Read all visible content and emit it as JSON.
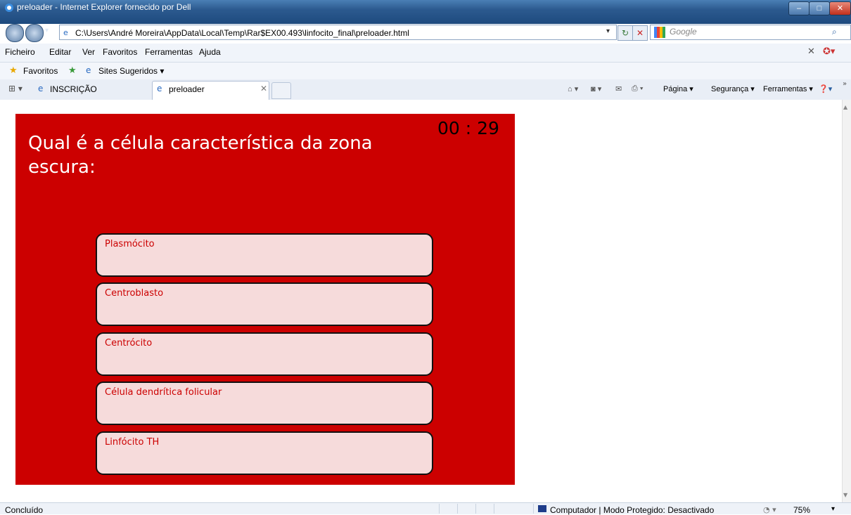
{
  "window": {
    "title": "preloader - Internet Explorer fornecido por Dell",
    "minimize": "–",
    "maximize": "□",
    "close": "✕"
  },
  "address_bar": {
    "url": "C:\\Users\\André Moreira\\AppData\\Local\\Temp\\Rar$EX00.493\\linfocito_final\\preloader.html",
    "search_placeholder": "Google"
  },
  "menu": {
    "items": [
      "Ficheiro",
      "Editar",
      "Ver",
      "Favoritos",
      "Ferramentas",
      "Ajuda"
    ]
  },
  "favorites_bar": {
    "favorites_label": "Favoritos",
    "sites_label": "Sites Sugeridos ▾"
  },
  "tabs": {
    "items": [
      {
        "label": "INSCRIÇÃO",
        "active": false
      },
      {
        "label": "preloader",
        "active": true
      }
    ],
    "close_glyph": "✕"
  },
  "command_bar": {
    "page": "Página ▾",
    "security": "Segurança ▾",
    "tools": "Ferramentas ▾"
  },
  "quiz": {
    "question": "Qual é a célula característica da zona escura:",
    "timer": "00 : 29",
    "answers": [
      "Plasmócito",
      "Centroblasto",
      "Centrócito",
      "Célula dendrítica folicular",
      "Linfócito TH"
    ],
    "colors": {
      "panel": "#cc0000",
      "answer_bg": "#f6dbdb",
      "answer_text": "#cc0000"
    }
  },
  "status_bar": {
    "status": "Concluído",
    "zone": "Computador | Modo Protegido: Desactivado",
    "zoom": "75%"
  }
}
